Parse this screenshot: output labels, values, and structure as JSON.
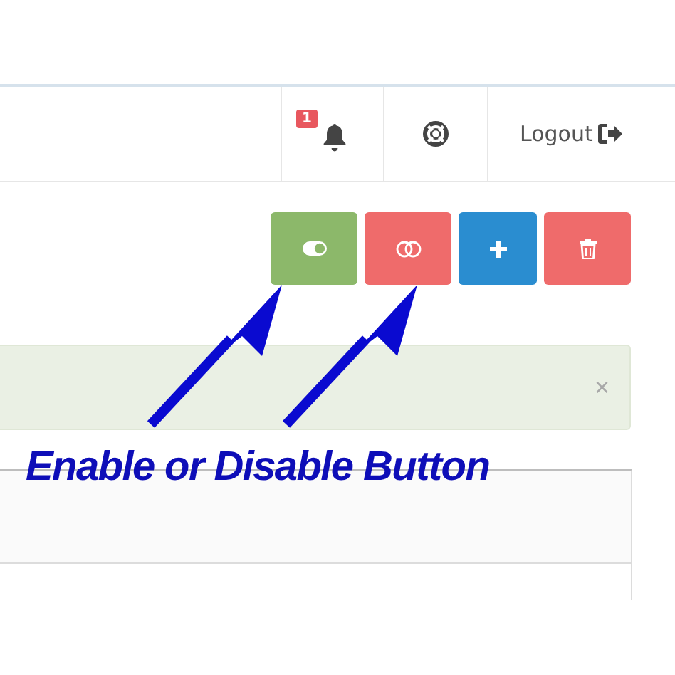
{
  "header": {
    "items": [
      {
        "kind": "notifications",
        "badge": "1"
      },
      {
        "kind": "help"
      },
      {
        "kind": "logout",
        "label": "Logout"
      }
    ]
  },
  "toolbar": {
    "buttons": [
      {
        "kind": "enable"
      },
      {
        "kind": "disable"
      },
      {
        "kind": "add"
      },
      {
        "kind": "delete"
      }
    ]
  },
  "alert": {
    "close": "×"
  },
  "annotation": {
    "text": "Enable or Disable Button"
  }
}
